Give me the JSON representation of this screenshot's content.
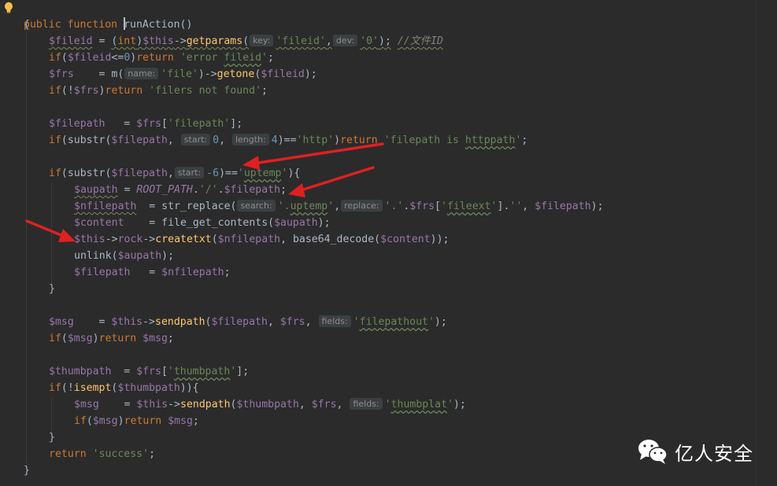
{
  "editor": {
    "theme_colors": {
      "background": "#2b2b2b",
      "keyword": "#cc7832",
      "variable": "#9876aa",
      "string": "#6a8759",
      "number": "#6897bb",
      "function": "#ffc66d",
      "comment": "#808080",
      "text": "#a9b7c6",
      "annotation_arrow": "#e02020"
    },
    "gutter_icon": "lightbulb-icon"
  },
  "code": {
    "l1": {
      "kw1": "public",
      "kw2": "function",
      "name": "runAction",
      "p": "()"
    },
    "l2": {
      "t": "{"
    },
    "l3": {
      "v": "$fileid",
      "eq": " = ",
      "p1": "(",
      "cast": "int",
      "p2": ")",
      "this": "$this",
      "arrow": "->",
      "fn": "getparams",
      "open": "(",
      "h1": "key:",
      "s1": "'fileid'",
      "comma": ",",
      "h2": "dev:",
      "s2": "'0'",
      "close": ");",
      "cmt": "//文件ID"
    },
    "l4": {
      "kw": "if",
      "p1": "(",
      "v": "$fileid",
      "op": "<=",
      "n": "0",
      "p2": ")",
      "kw2": "return",
      "s": "'error ",
      "sq": "fileid",
      "s2": "'",
      "semi": ";"
    },
    "l5": {
      "v": "$frs",
      "pad": "    = ",
      "fn": "m(",
      "h": "name:",
      "s": "'file'",
      "p": ")->",
      "fn2": "getone",
      "p2": "(",
      "v2": "$fileid",
      "p3": ");"
    },
    "l6": {
      "kw": "if",
      "p1": "(!",
      "v": "$frs",
      "p2": ")",
      "kw2": "return",
      "s": "'filers not found'",
      "semi": ";"
    },
    "l8": {
      "v": "$filepath",
      "pad": "   = ",
      "v2": "$frs",
      "b": "[",
      "s": "'filepath'",
      "e": "];"
    },
    "l9": {
      "kw": "if",
      "p1": "(substr(",
      "v": "$filepath",
      "c1": ", ",
      "h1": "start:",
      "n1": "0",
      "c2": ", ",
      "h2": "length:",
      "n2": "4",
      "p2": ")==",
      "s": "'http'",
      "p3": ")",
      "kw2": "return",
      "s2a": "'filepath is ",
      "sq": "httppath",
      "s2b": "'",
      "semi": ";"
    },
    "l11": {
      "kw": "if",
      "p1": "(substr(",
      "v": "$filepath",
      "c1": ",",
      "h1": "start:",
      "n1": "-6",
      "p2": ")==",
      "s1": "'",
      "sq": "uptemp",
      "s2": "'",
      "p3": "){"
    },
    "l12": {
      "v": "$aupath",
      "eq": " = ",
      "c": "ROOT_PATH",
      "dot": ".",
      "s": "'/'",
      "dot2": ".",
      "v2": "$filepath",
      "semi": ";"
    },
    "l13": {
      "v": "$nfilepath",
      "pad": "  = ",
      "fn": "str_replace(",
      "h1": "search:",
      "s1a": "'.",
      "sq1": "uptemp",
      "s1b": "'",
      "c1": ",",
      "h2": "replace:",
      "s2": "'.'",
      "d1": ".",
      "v2": "$frs",
      "b": "[",
      "s3a": "'",
      "sq2": "fileext",
      "s3b": "'",
      "b2": "]",
      "d2": ".",
      "s4": "''",
      "c2": ", ",
      "v3": "$filepath",
      "e": ");"
    },
    "l14": {
      "v": "$content",
      "pad": "    = ",
      "fn": "file_get_contents(",
      "v2": "$aupath",
      "e": ");"
    },
    "l15": {
      "v": "$this",
      "a1": "->",
      "p": "rock",
      "a2": "->",
      "fn": "createtxt",
      "o": "(",
      "v2": "$nfilepath",
      "c": ", ",
      "fn2": "base64_decode(",
      "v3": "$content",
      "e": "));"
    },
    "l16": {
      "fn": "unlink(",
      "v": "$aupath",
      "e": ");"
    },
    "l17": {
      "v": "$filepath",
      "pad": "   = ",
      "v2": "$nfilepath",
      "semi": ";"
    },
    "l18": {
      "t": "}"
    },
    "l20": {
      "v": "$msg",
      "pad": "    = ",
      "v2": "$this",
      "a": "->",
      "fn": "sendpath",
      "o": "(",
      "v3": "$filepath",
      "c1": ", ",
      "v4": "$frs",
      "c2": ", ",
      "h": "fields:",
      "s1": "'",
      "sq": "filepathout",
      "s2": "'",
      "e": ");"
    },
    "l21": {
      "kw": "if",
      "p1": "(",
      "v": "$msg",
      "p2": ")",
      "kw2": "return",
      "v2": "$msg",
      "semi": ";"
    },
    "l23": {
      "v": "$thumbpath",
      "pad": "  = ",
      "v2": "$frs",
      "b": "[",
      "s1": "'",
      "sq": "thumbpath",
      "s2": "'",
      "e": "];"
    },
    "l24": {
      "kw": "if",
      "p1": "(!",
      "fn": "isempt",
      "o": "(",
      "v": "$thumbpath",
      "e": ")){"
    },
    "l25": {
      "v": "$msg",
      "pad": "    = ",
      "v2": "$this",
      "a": "->",
      "fn": "sendpath",
      "o": "(",
      "v3": "$thumbpath",
      "c1": ", ",
      "v4": "$frs",
      "c2": ", ",
      "h": "fields:",
      "s1": "'",
      "sq": "thumbplat",
      "s2": "'",
      "e": ");"
    },
    "l26": {
      "kw": "if",
      "p1": "(",
      "v": "$msg",
      "p2": ")",
      "kw2": "return",
      "v2": "$msg",
      "semi": ";"
    },
    "l27": {
      "t": "}"
    },
    "l28": {
      "kw": "return",
      "s": "'success'",
      "semi": ";"
    },
    "l29": {
      "t": "}"
    }
  },
  "watermark": {
    "icon": "wechat-icon",
    "text": "亿人安全"
  }
}
